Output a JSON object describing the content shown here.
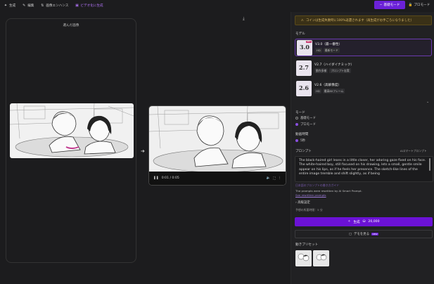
{
  "topbar": {
    "tabs": [
      {
        "icon": "sparkle-icon",
        "label": "生成"
      },
      {
        "icon": "pencil-icon",
        "label": "編集"
      },
      {
        "icon": "enhance-icon",
        "label": "画像エンハンス"
      },
      {
        "icon": "video-icon",
        "label": "ビデオ化に生成"
      }
    ],
    "basic_mode": "基礎モード",
    "pro_mode": "プロモード"
  },
  "canvas": {
    "source_title": "選んだ画像",
    "video_time": "0:01 / 0:05"
  },
  "panel": {
    "warning": "コインは生成失敗時に100%返還されます（再生成がお手ごろになりました）",
    "model_label": "モデル",
    "models": [
      {
        "thumb": "3.0",
        "name": "V3.0（最一番性）",
        "tags": [
          "HD",
          "最新モード"
        ],
        "badge": "NEW"
      },
      {
        "thumb": "2.7",
        "name": "V2.7（ハイダイナミック）",
        "tags": [
          "動作多様",
          "プロンプト忠実"
        ]
      },
      {
        "thumb": "2.6",
        "name": "V2.6（高解像度）",
        "tags": [
          "HD",
          "最高60フレーム"
        ]
      }
    ],
    "mode_label": "モード",
    "modes": [
      "基礎モード",
      "プロモード"
    ],
    "duration_label": "動画時間",
    "duration_value": "5秒",
    "prompt_label": "プロンプト",
    "ai_prompt_label": "AIスマートプロンプト",
    "prompt_text": "The black-haired girl leans in a little closer, her adoring gaze fixed on his face. The white-haired boy, still focused on his drawing, lets a small, gentle smile appear on his lips, as if he feels her presence. The sketch-like lines of the entire image tremble and shift slightly, as if being",
    "prompt_note": "日本語のプロンプトの書き方ガイド",
    "rewritten": "The prompts were rewritten by AI Smart Prompt.",
    "see_prompts": "See rewritten prompts",
    "advanced": "高級設定",
    "estimate": "予想の所要時間：5 分",
    "generate": "生成",
    "cost": "20,000",
    "demo": "デモを見る",
    "demo_badge": "NEW",
    "presets_label": "動きプリセット"
  }
}
